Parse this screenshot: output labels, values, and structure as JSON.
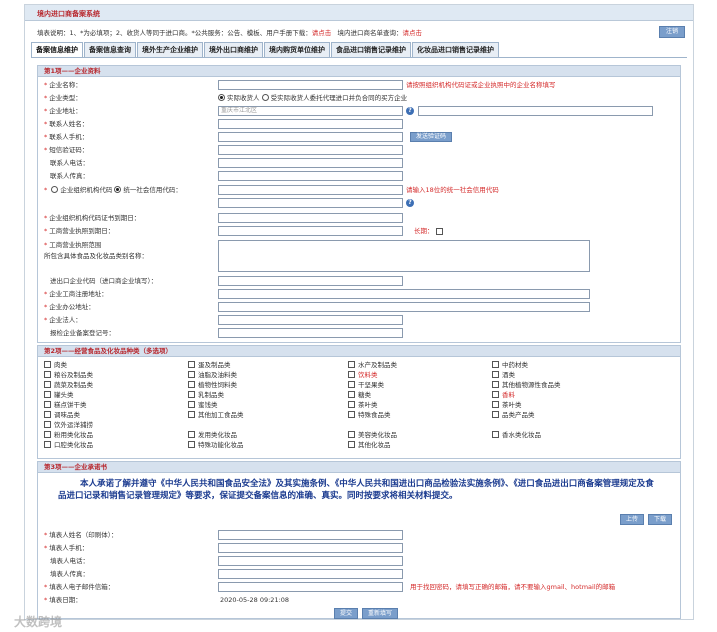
{
  "app": {
    "title": "境内进口商备案系统"
  },
  "notice": {
    "part1": "填表说明：1、*为必填项；2、收货人等同于进口商。*公共服务：公告、模板、用户手册下载：",
    "link1": "请点击",
    "part2": "境内进口商名单查询：",
    "link2": "请点击"
  },
  "top_button": "注销",
  "tabs": [
    "备案信息维护",
    "备案信息查询",
    "境外生产企业维护",
    "境外出口商维护",
    "境内购货单位维护",
    "食品进口销售记录维护",
    "化妆品进口销售记录维护"
  ],
  "section1": {
    "title": "第1项——企业资料",
    "fields": {
      "company_name": "企业名称：",
      "company_name_hint": "请按照组织机构代码证或企业执照中的企业名称填写",
      "company_type": "企业类型：",
      "type_option1": "实际收货人",
      "type_option2": "受实际收货人委托代理进口并负合同的买方企业",
      "address": "企业地址：",
      "address_placeholder": "重庆市江北区",
      "contact_name": "联系人姓名：",
      "contact_phone": "联系人手机：",
      "verify_btn": "发送验证码",
      "sms_code": "短信验证码：",
      "contact_tel": "联系人电话：",
      "contact_fax": "联系人传真：",
      "org_code_opt": "企业组织机构代码",
      "credit_code_opt": "统一社会信用代码：",
      "credit_hint": "请输入18位的统一社会信用代码",
      "org_cert_date": "企业组织机构代码证书到期日：",
      "license_expire": "工商营业执照到期日：",
      "long_term": "长期：",
      "business_scope": "工商营业执照范围",
      "business_scope2": "所包含具体食品及化妆品类别名称：",
      "ie_code": "进出口企业代码（进口商企业填写）：",
      "reg_address": "企业工商注册地址：",
      "office_address": "企业办公地址：",
      "legal_rep": "企业法人：",
      "filing_no": "报检企业备案登记号："
    }
  },
  "section2": {
    "title": "第2项——经营食品及化妆品种类（多选项）",
    "columns": [
      [
        "肉类",
        "粮谷及制品类",
        "蔬菜及制品类",
        "罐头类",
        "糕点饼干类",
        "调味品类",
        "饮外运洋捕捞",
        "粉用类化妆品",
        "口腔类化妆品"
      ],
      [
        "蛋及制品类",
        "油脂及油料类",
        "植物性饲料类",
        "乳制品类",
        "蜜饯类",
        "其他加工食品类",
        "",
        "发用类化妆品",
        "特殊功能化妆品"
      ],
      [
        "水产及制品类",
        "饮料类",
        "干坚果类",
        "糖类",
        "茶叶类",
        "特殊食品类",
        "",
        "美容类化妆品",
        "其他化妆品"
      ],
      [
        "中药材类",
        "酒类",
        "其他植物源性食品类",
        "香料",
        "茶叶类",
        "品类产品类",
        "",
        "香水类化妆品",
        ""
      ]
    ],
    "red_items": [
      "饮料类",
      "香料"
    ]
  },
  "section3": {
    "title": "第3项——企业承诺书",
    "pledge": "本人承诺了解并遵守《中华人民共和国食品安全法》及其实施条例、《中华人民共和国进出口商品检验法实施条例》、《进口食品进出口商备案管理规定及食品进口记录和销售记录管理规定》等要求，保证提交备案信息的准确、真实。同时按要求将相关材料提交。",
    "btn_upload": "上传",
    "btn_view": "下载",
    "fields": {
      "filler_name": "填表人姓名（印刷体）：",
      "filler_phone": "填表人手机：",
      "filler_tel": "填表人电话：",
      "filler_fax": "填表人传真：",
      "filler_email": "填表人电子邮件信箱：",
      "email_hint": "用于找回密码，请填写正确的邮箱，请不要输入gmail、hotmail的邮箱",
      "fill_date": "填表日期：",
      "fill_date_value": "2020-05-28 09:21:08"
    }
  },
  "bottom": {
    "submit": "提交",
    "reset": "重新填写"
  },
  "watermark": "大数跨境",
  "colors": {
    "accent": "#b8292f",
    "header_bg": "#d6e1ee",
    "button": "#7a9ecb",
    "pledge": "#1a3a8f"
  }
}
